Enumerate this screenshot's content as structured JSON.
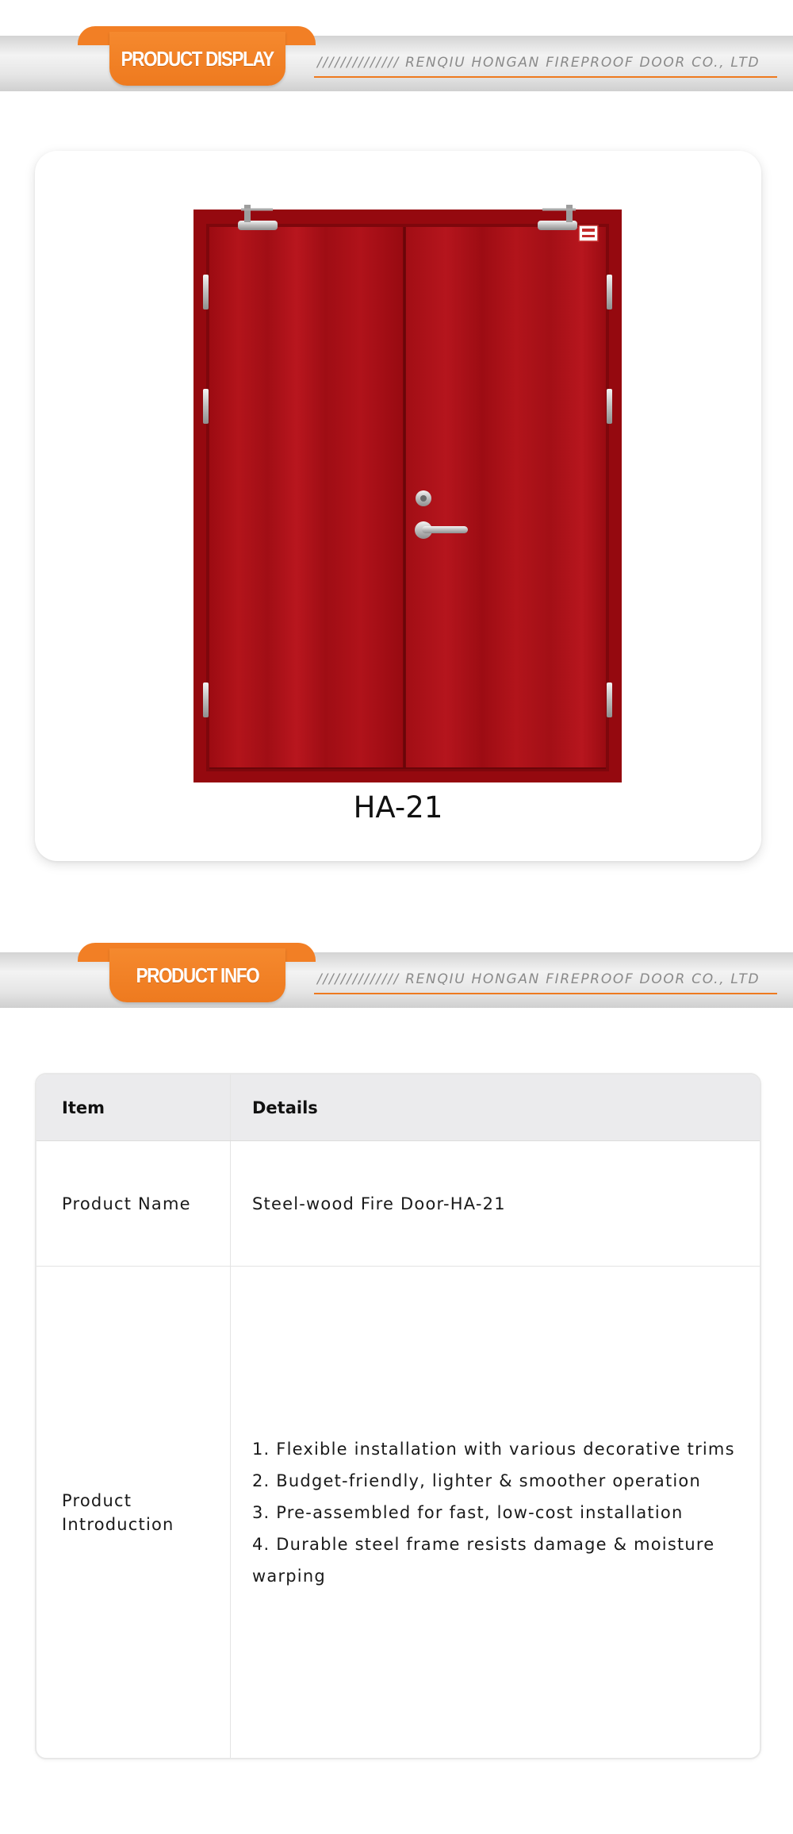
{
  "display_section": {
    "title": "PRODUCT DISPLAY",
    "company": "////////////// RENQIU HONGAN FIREPROOF DOOR CO., LTD"
  },
  "product_card": {
    "model": "HA-21",
    "door_color": "#a80f17"
  },
  "info_section": {
    "title": "PRODUCT INFO",
    "company": "////////////// RENQIU HONGAN FIREPROOF DOOR CO., LTD"
  },
  "info_table": {
    "headers": [
      "Item",
      "Details"
    ],
    "rows": [
      {
        "item": "Product Name",
        "details": "Steel-wood Fire Door-HA-21"
      },
      {
        "item_lines": [
          "Product",
          "Introduction"
        ],
        "details_list": [
          "1. Flexible installation with various decorative trims",
          "2. Budget-friendly, lighter & smoother operation",
          "3. Pre-assembled for fast, low-cost installation",
          "4. Durable steel frame resists damage & moisture warping"
        ]
      }
    ]
  },
  "colors": {
    "accent_orange": "#ee7a1f",
    "banner_gray": "#e6e6e6",
    "table_header": "#ebebed"
  }
}
